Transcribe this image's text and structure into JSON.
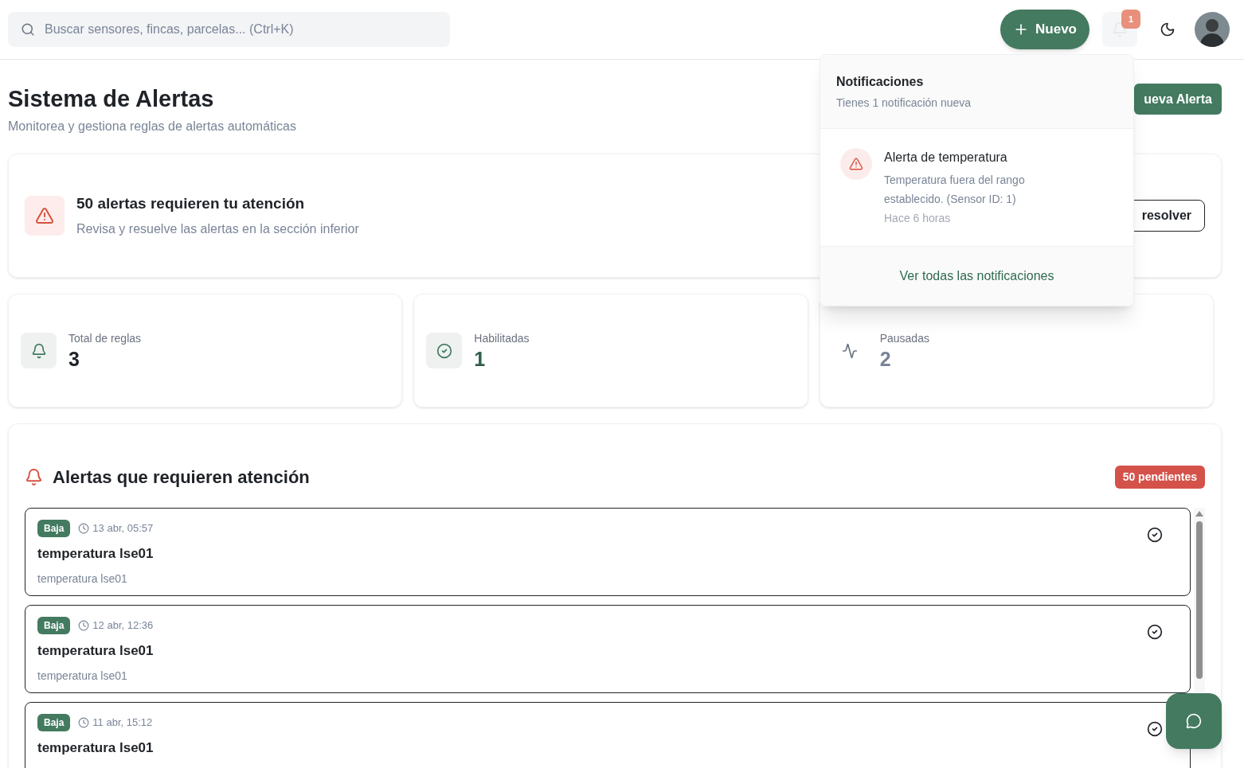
{
  "header": {
    "search": {
      "placeholder": "Buscar sensores, fincas, parcelas... (Ctrl+K)"
    },
    "new_button": "Nuevo",
    "notifications_badge": "1"
  },
  "page": {
    "title": "Sistema de Alertas",
    "subtitle": "Monitorea y gestiona reglas de alertas automáticas",
    "new_alert_button": "ueva Alerta"
  },
  "banner": {
    "title": "50 alertas requieren tu atención",
    "text": "Revisa y resuelve las alertas en la sección inferior",
    "button": "resolver"
  },
  "stats": [
    {
      "kind": "bell",
      "label": "Total de reglas",
      "value": "3"
    },
    {
      "kind": "check",
      "label": "Habilitadas",
      "value": "1"
    },
    {
      "kind": "activity",
      "label": "Pausadas",
      "value": "2"
    }
  ],
  "alerts_panel": {
    "title": "Alertas que requieren atención",
    "badge": "50 pendientes",
    "alerts": [
      {
        "severity": "Baja",
        "time": "13 abr, 05:57",
        "title": "temperatura lse01",
        "description": "temperatura lse01"
      },
      {
        "severity": "Baja",
        "time": "12 abr, 12:36",
        "title": "temperatura lse01",
        "description": "temperatura lse01"
      },
      {
        "severity": "Baja",
        "time": "11 abr, 15:12",
        "title": "temperatura lse01"
      }
    ]
  },
  "notifications_menu": {
    "title": "Notificaciones",
    "subtitle": "Tienes 1 notificación nueva",
    "items": [
      {
        "title": "Alerta de temperatura",
        "text": "Temperatura fuera del rango establecido. (Sensor ID: 1)",
        "time": "Hace 6 horas"
      }
    ],
    "footer_link": "Ver todas las notificaciones"
  }
}
